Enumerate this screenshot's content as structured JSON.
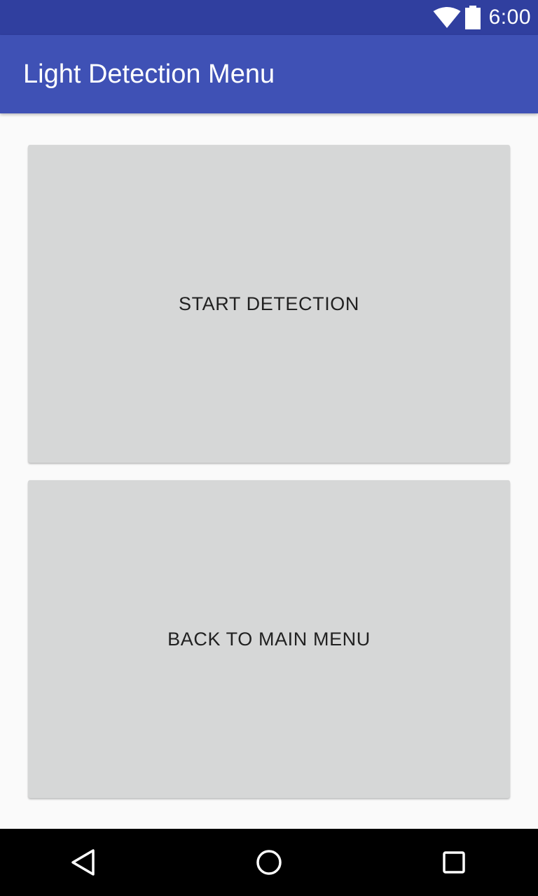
{
  "status_bar": {
    "time": "6:00",
    "icons": [
      "wifi-icon",
      "battery-icon"
    ]
  },
  "app_bar": {
    "title": "Light Detection Menu"
  },
  "buttons": {
    "start_detection": "START DETECTION",
    "back_to_main_menu": "BACK TO MAIN MENU"
  },
  "nav_bar": {
    "icons": [
      "back-icon",
      "home-icon",
      "recents-icon"
    ]
  },
  "colors": {
    "status_bar": "#303f9f",
    "app_bar": "#3f51b5",
    "background": "#fafafa",
    "button": "#d6d7d7",
    "button_text": "#212121",
    "nav_bar": "#000000"
  }
}
